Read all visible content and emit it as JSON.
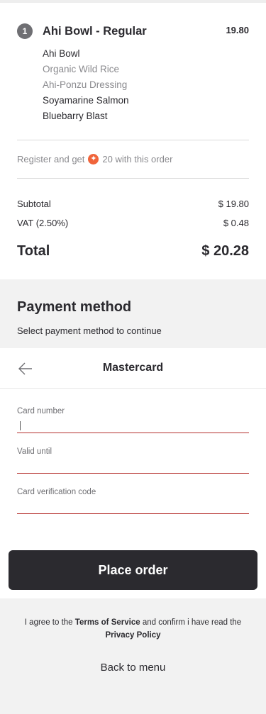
{
  "order": {
    "items": [
      {
        "qty": "1",
        "name": "Ahi Bowl - Regular",
        "price": "19.80",
        "modifiers": [
          {
            "text": "Ahi Bowl",
            "tone": "dark"
          },
          {
            "text": "Organic Wild Rice",
            "tone": "grey"
          },
          {
            "text": "Ahi-Ponzu Dressing",
            "tone": "grey"
          },
          {
            "text": "Soyamarine Salmon",
            "tone": "dark"
          },
          {
            "text": "Bluebarry Blast",
            "tone": "dark"
          }
        ]
      }
    ],
    "reward": {
      "prefix": "Register and get",
      "icon": "star-coin-icon",
      "points": "20 with this order"
    },
    "subtotal_label": "Subtotal",
    "subtotal_value": "$ 19.80",
    "vat_label": "VAT (2.50%)",
    "vat_value": "$ 0.48",
    "total_label": "Total",
    "total_value": "$ 20.28"
  },
  "payment": {
    "title": "Payment method",
    "subtitle": "Select payment method to continue",
    "selected_method": "Mastercard",
    "back_icon": "arrow-left-icon",
    "fields": [
      {
        "label": "Card number",
        "value": ""
      },
      {
        "label": "Valid until",
        "value": ""
      },
      {
        "label": "Card verification code",
        "value": ""
      }
    ]
  },
  "actions": {
    "place_order": "Place order",
    "back_to_menu": "Back to menu"
  },
  "legal": {
    "prefix": "I agree to the",
    "terms": "Terms of Service",
    "middle": "and confirm i have read the",
    "privacy": "Privacy Policy"
  },
  "colors": {
    "accent_red": "#b5302e",
    "button_dark": "#2b2a2f",
    "coin_orange": "#f0643a"
  }
}
